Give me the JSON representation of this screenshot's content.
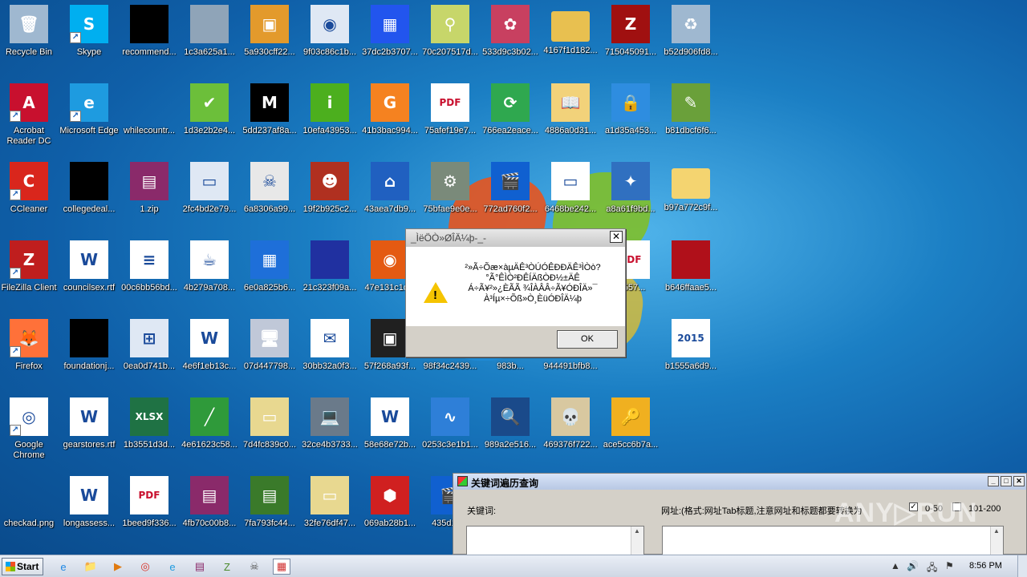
{
  "desktop_icons": [
    {
      "label": "Recycle Bin",
      "icon": "recycle-bin-icon",
      "color": "#9fb8d0",
      "glyph": "🗑",
      "shortcut": false
    },
    {
      "label": "Skype",
      "icon": "skype-icon",
      "color": "#00aff0",
      "glyph": "S",
      "shortcut": true
    },
    {
      "label": "recommend...",
      "icon": "black-file-icon",
      "color": "#000000",
      "glyph": "",
      "shortcut": false
    },
    {
      "label": "1c3a625a1...",
      "icon": "noise-image-icon",
      "color": "#8fa4b8",
      "glyph": "",
      "shortcut": false
    },
    {
      "label": "5a930cff22...",
      "icon": "package-icon",
      "color": "#e39a2c",
      "glyph": "▣",
      "shortcut": false
    },
    {
      "label": "9f03c86c1b...",
      "icon": "media-file-icon",
      "color": "#dfe8f4",
      "glyph": "◉",
      "shortcut": false
    },
    {
      "label": "37dc2b3707...",
      "icon": "color-blocks-icon",
      "color": "#2255ee",
      "glyph": "▦",
      "shortcut": false
    },
    {
      "label": "70c207517d...",
      "icon": "usb-icon",
      "color": "#c7d66a",
      "glyph": "⚲",
      "shortcut": false
    },
    {
      "label": "533d9c3b02...",
      "icon": "pattern-icon",
      "color": "#c84060",
      "glyph": "✿",
      "shortcut": false
    },
    {
      "label": "4167f1d182...",
      "icon": "folder-icon",
      "color": "#e8c050",
      "glyph": "",
      "shortcut": false
    },
    {
      "label": "715045091...",
      "icon": "game-icon",
      "color": "#a01010",
      "glyph": "Z",
      "shortcut": false
    },
    {
      "label": "b52d906fd8...",
      "icon": "recycle-full-icon",
      "color": "#9fb8d0",
      "glyph": "♻",
      "shortcut": false
    },
    {
      "label": "Acrobat Reader DC",
      "icon": "acrobat-icon",
      "color": "#c8102e",
      "glyph": "A",
      "shortcut": true
    },
    {
      "label": "Microsoft Edge",
      "icon": "edge-icon",
      "color": "#1e9be0",
      "glyph": "e",
      "shortcut": true
    },
    {
      "label": "whilecountr...",
      "icon": "blank-file-icon",
      "color": "#1b7fc4",
      "glyph": "",
      "shortcut": false
    },
    {
      "label": "1d3e2b2e4...",
      "icon": "shield-check-icon",
      "color": "#6cbf3a",
      "glyph": "✔",
      "shortcut": false
    },
    {
      "label": "5dd237af8a...",
      "icon": "m-logo-icon",
      "color": "#000000",
      "glyph": "M",
      "shortcut": false
    },
    {
      "label": "10efa43953...",
      "icon": "info-icon",
      "color": "#4caf1e",
      "glyph": "i",
      "shortcut": false
    },
    {
      "label": "41b3bac994...",
      "icon": "orange-box-icon",
      "color": "#f58220",
      "glyph": "G",
      "shortcut": false
    },
    {
      "label": "75afef19e7...",
      "icon": "pdf-icon",
      "color": "#ffffff",
      "glyph": "PDF",
      "shortcut": false
    },
    {
      "label": "766ea2eace...",
      "icon": "sync-arrows-icon",
      "color": "#2fa84f",
      "glyph": "⟳",
      "shortcut": false
    },
    {
      "label": "4886a0d31...",
      "icon": "book-icon",
      "color": "#f2d27a",
      "glyph": "📖",
      "shortcut": false
    },
    {
      "label": "a1d35a453...",
      "icon": "lock-box-icon",
      "color": "#2e8de0",
      "glyph": "🔒",
      "shortcut": false
    },
    {
      "label": "b81dbcf6f6...",
      "icon": "image-edit-icon",
      "color": "#6aa03a",
      "glyph": "✎",
      "shortcut": false
    },
    {
      "label": "CCleaner",
      "icon": "ccleaner-icon",
      "color": "#d9261c",
      "glyph": "C",
      "shortcut": true
    },
    {
      "label": "collegedeal...",
      "icon": "black-file-icon",
      "color": "#000000",
      "glyph": "",
      "shortcut": false
    },
    {
      "label": "1.zip",
      "icon": "winrar-icon",
      "color": "#8a2a6a",
      "glyph": "▤",
      "shortcut": false
    },
    {
      "label": "2fc4bd2e79...",
      "icon": "window-icon",
      "color": "#dfe8f4",
      "glyph": "▭",
      "shortcut": false
    },
    {
      "label": "6a8306a99...",
      "icon": "skull-crossbones-icon",
      "color": "#e8e8e8",
      "glyph": "☠",
      "shortcut": false
    },
    {
      "label": "19f2b925c2...",
      "icon": "anime-face-icon",
      "color": "#b03020",
      "glyph": "☻",
      "shortcut": false
    },
    {
      "label": "43aea7db9...",
      "icon": "network-icon",
      "color": "#2060c0",
      "glyph": "⌂",
      "shortcut": false
    },
    {
      "label": "75bfae9e0e...",
      "icon": "installer-icon",
      "color": "#7a8a7a",
      "glyph": "⚙",
      "shortcut": false
    },
    {
      "label": "772ad760f2...",
      "icon": "clapper-icon",
      "color": "#1060d0",
      "glyph": "🎬",
      "shortcut": false
    },
    {
      "label": "6468be242...",
      "icon": "app-window-icon",
      "color": "#ffffff",
      "glyph": "▭",
      "shortcut": false
    },
    {
      "label": "a8a61f9bd...",
      "icon": "broom-icon",
      "color": "#3070c0",
      "glyph": "✦",
      "shortcut": false
    },
    {
      "label": "b97a772c9f...",
      "icon": "folder-icon",
      "color": "#f4d470",
      "glyph": "",
      "shortcut": false
    },
    {
      "label": "FileZilla Client",
      "icon": "filezilla-icon",
      "color": "#bf1e1e",
      "glyph": "Z",
      "shortcut": true
    },
    {
      "label": "councilsex.rtf",
      "icon": "word-doc-icon",
      "color": "#ffffff",
      "glyph": "W",
      "shortcut": false
    },
    {
      "label": "00c6bb56bd...",
      "icon": "text-doc-icon",
      "color": "#ffffff",
      "glyph": "≡",
      "shortcut": false
    },
    {
      "label": "4b279a708...",
      "icon": "java-icon",
      "color": "#ffffff",
      "glyph": "☕",
      "shortcut": false
    },
    {
      "label": "6e0a825b6...",
      "icon": "calculator-icon",
      "color": "#1e6fd9",
      "glyph": "▦",
      "shortcut": false
    },
    {
      "label": "21c323f09a...",
      "icon": "noise-blue-icon",
      "color": "#2030a0",
      "glyph": "",
      "shortcut": false
    },
    {
      "label": "47e131c1c...",
      "icon": "firefox-orb-icon",
      "color": "#e45a12",
      "glyph": "◉",
      "shortcut": false
    },
    {
      "label": "f6557...",
      "icon": "pdf-icon",
      "color": "#ffffff",
      "glyph": "PDF",
      "shortcut": false
    },
    {
      "label": "b646ffaae5...",
      "icon": "noise-red-icon",
      "color": "#b0101a",
      "glyph": "",
      "shortcut": false
    },
    {
      "label": "Firefox",
      "icon": "firefox-icon",
      "color": "#ff7139",
      "glyph": "🦊",
      "shortcut": true
    },
    {
      "label": "foundationj...",
      "icon": "black-file-icon",
      "color": "#000000",
      "glyph": "",
      "shortcut": false
    },
    {
      "label": "0ea0d741b...",
      "icon": "windows-installer-icon",
      "color": "#dfe8f4",
      "glyph": "⊞",
      "shortcut": false
    },
    {
      "label": "4e6f1eb13c...",
      "icon": "word-doc-icon",
      "color": "#ffffff",
      "glyph": "W",
      "shortcut": false
    },
    {
      "label": "07d447798...",
      "icon": "computer-setup-icon",
      "color": "#c0c8d8",
      "glyph": "🖥",
      "shortcut": false
    },
    {
      "label": "30bb32a0f3...",
      "icon": "mail-icon",
      "color": "#ffffff",
      "glyph": "✉",
      "shortcut": false
    },
    {
      "label": "57f268a93f...",
      "icon": "id-card-icon",
      "color": "#202020",
      "glyph": "▣",
      "shortcut": false
    },
    {
      "label": "98f34c2439...",
      "icon": "blank-file-icon",
      "color": "#1b7fc4",
      "glyph": "",
      "shortcut": false
    },
    {
      "label": "983b...",
      "icon": "blank-file-icon",
      "color": "#1b7fc4",
      "glyph": "",
      "shortcut": false
    },
    {
      "label": "944491bfb8...",
      "icon": "blank-file-icon",
      "color": "#1b7fc4",
      "glyph": "",
      "shortcut": false
    },
    {
      "label": "b1555a6d9...",
      "icon": "2015-app-icon",
      "color": "#ffffff",
      "glyph": "2015",
      "shortcut": false
    },
    {
      "label": "Google Chrome",
      "icon": "chrome-icon",
      "color": "#ffffff",
      "glyph": "◎",
      "shortcut": true
    },
    {
      "label": "gearstores.rtf",
      "icon": "word-doc-icon",
      "color": "#ffffff",
      "glyph": "W",
      "shortcut": false
    },
    {
      "label": "1b3551d3d...",
      "icon": "excel-icon",
      "color": "#1f7244",
      "glyph": "XLSX",
      "shortcut": false
    },
    {
      "label": "4e61623c58...",
      "icon": "chart-image-icon",
      "color": "#2f9a3a",
      "glyph": "╱",
      "shortcut": false
    },
    {
      "label": "7d4fc839c0...",
      "icon": "installer-shield-icon",
      "color": "#e8d890",
      "glyph": "▭",
      "shortcut": false
    },
    {
      "label": "32ce4b3733...",
      "icon": "laptop-icon",
      "color": "#6a7a8a",
      "glyph": "💻",
      "shortcut": false
    },
    {
      "label": "58e68e72b...",
      "icon": "word-doc-icon",
      "color": "#ffffff",
      "glyph": "W",
      "shortcut": false
    },
    {
      "label": "0253c3e1b1...",
      "icon": "shield-pulse-icon",
      "color": "#2e7fd8",
      "glyph": "∿",
      "shortcut": false
    },
    {
      "label": "989a2e516...",
      "icon": "search-monitor-icon",
      "color": "#1a4a8a",
      "glyph": "🔍",
      "shortcut": false
    },
    {
      "label": "469376f722...",
      "icon": "skull-icon",
      "color": "#d8c8a0",
      "glyph": "💀",
      "shortcut": false
    },
    {
      "label": "ace5cc6b7a...",
      "icon": "key-icon",
      "color": "#f0b020",
      "glyph": "🔑",
      "shortcut": false
    },
    {
      "label": "checkad.png",
      "icon": "blank-file-icon",
      "color": "#1b7fc4",
      "glyph": "",
      "shortcut": false
    },
    {
      "label": "longassess...",
      "icon": "word-doc-icon",
      "color": "#ffffff",
      "glyph": "W",
      "shortcut": false
    },
    {
      "label": "1beed9f336...",
      "icon": "pdf-icon",
      "color": "#ffffff",
      "glyph": "PDF",
      "shortcut": false
    },
    {
      "label": "4fb70c00b8...",
      "icon": "winrar-icon",
      "color": "#8a2a6a",
      "glyph": "▤",
      "shortcut": false
    },
    {
      "label": "7fa793fc44...",
      "icon": "winrar-icon",
      "color": "#3a7a2a",
      "glyph": "▤",
      "shortcut": false
    },
    {
      "label": "32fe76df47...",
      "icon": "installer-shield-icon",
      "color": "#e8d890",
      "glyph": "▭",
      "shortcut": false
    },
    {
      "label": "069ab28b1...",
      "icon": "setup-box-icon",
      "color": "#d02020",
      "glyph": "⬢",
      "shortcut": false
    },
    {
      "label": "435d1a...",
      "icon": "clapper-icon",
      "color": "#1060d0",
      "glyph": "🎬",
      "shortcut": false
    }
  ],
  "message_box": {
    "title": "_ÌëÖÒ»ØÎÄ¼þ-_-",
    "message": "²»Ã÷Õæ×àµÄÊ³ÒÚÓÊÐÐÄÊ³ÌÒò?\n°Ã°ÊÌÒ²ÐÊÍÄßÒÐ½±ÄÊ\nÁ÷Ã¥²»¿ÈÃÃ ¾ÎÀÂÂ÷Ã¥ÓÐÎÄ»¯\nÀ³Íµ×÷Õß»Ò¸ÈüÓÐÎÄ¼þ",
    "ok_label": "OK",
    "close_glyph": "✕"
  },
  "keyword_window": {
    "title": "关键词遍历查询",
    "keyword_label": "关键词:",
    "url_label": "网址:(格式:网址Tab标题,注意网址和标题都要转换为",
    "range1_label": "0-50",
    "range2_label": "101-200",
    "range1_checked": true,
    "range2_checked": false,
    "minimize_glyph": "_",
    "maximize_glyph": "□",
    "close_glyph": "✕"
  },
  "watermark": "ANY▷RUN",
  "taskbar": {
    "start_label": "Start",
    "pinned": [
      {
        "icon": "ie-icon",
        "glyph": "e",
        "color": "#1e88e5"
      },
      {
        "icon": "explorer-icon",
        "glyph": "📁",
        "color": "#e8b830"
      },
      {
        "icon": "media-player-icon",
        "glyph": "▶",
        "color": "#e07a10"
      },
      {
        "icon": "chrome-icon",
        "glyph": "◎",
        "color": "#d93025"
      },
      {
        "icon": "edge-icon",
        "glyph": "e",
        "color": "#1e9be0"
      },
      {
        "icon": "winrar-icon",
        "glyph": "▤",
        "color": "#8a2a6a"
      },
      {
        "icon": "archive-icon",
        "glyph": "Z",
        "color": "#4a8a2a"
      },
      {
        "icon": "skull-icon",
        "glyph": "☠",
        "color": "#555555"
      },
      {
        "icon": "app-window-icon",
        "glyph": "▦",
        "color": "#d03030"
      }
    ],
    "clock": "8:56 PM"
  },
  "colors": {
    "desktop_blue": "#1b7fc4",
    "dialog_gray": "#d4d0c8"
  }
}
